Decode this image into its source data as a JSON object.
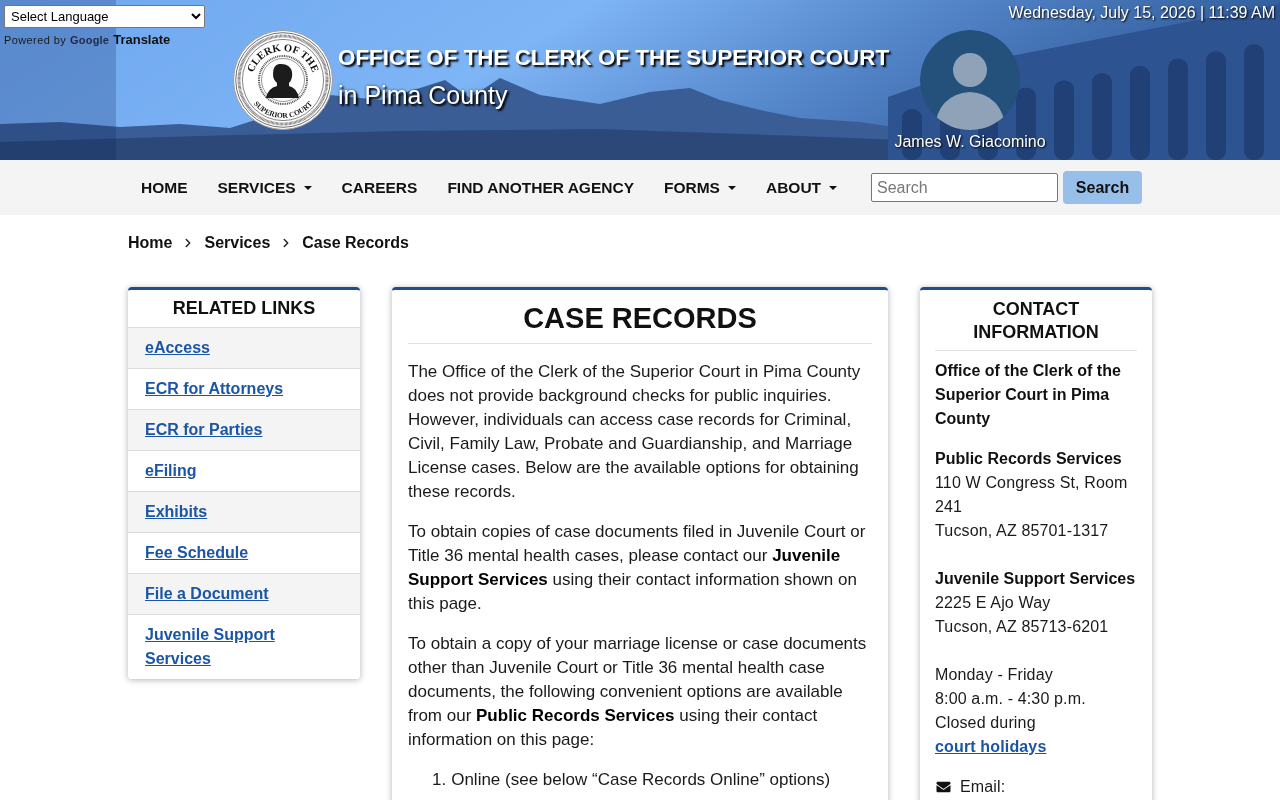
{
  "translate": {
    "select": {
      "value": "Select Language"
    },
    "powered_by": "Powered by",
    "google": "Google",
    "translate": "Translate"
  },
  "header": {
    "datetime": "Wednesday, July 15, 2026 | 11:39 AM",
    "seal": {
      "top_text": "CLERK OF THE",
      "bottom_text": "SUPERIOR COURT"
    },
    "title": "OFFICE OF THE CLERK OF THE SUPERIOR COURT",
    "subtitle": "in Pima County",
    "official_name": "James W. Giacomino"
  },
  "nav": {
    "items": [
      {
        "label": "HOME",
        "kind": "link"
      },
      {
        "label": "SERVICES",
        "kind": "dropdown"
      },
      {
        "label": "CAREERS",
        "kind": "link"
      },
      {
        "label": "FIND ANOTHER AGENCY",
        "kind": "link"
      },
      {
        "label": "FORMS",
        "kind": "dropdown"
      },
      {
        "label": "ABOUT",
        "kind": "dropdown"
      }
    ],
    "search": {
      "placeholder": "Search"
    },
    "search_button": "Search"
  },
  "breadcrumb": [
    "Home",
    "Services",
    "Case Records"
  ],
  "related_links": {
    "title": "RELATED LINKS",
    "items": [
      "eAccess",
      "ECR for Attorneys",
      "ECR for Parties",
      "eFiling",
      "Exhibits",
      "Fee Schedule",
      "File a Document",
      "Juvenile Support Services"
    ]
  },
  "main": {
    "title": "CASE RECORDS",
    "paragraphs": [
      "The Office of the Clerk of the Superior Court in Pima County does not provide background checks for public inquiries. However, individuals can access case records for Criminal, Civil, Family Law, Probate and Guardianship, and Marriage License cases. Below are the available options for obtaining these records.",
      "To obtain copies of case documents filed in Juvenile Court or Title 36 mental health cases, please contact our **Juvenile Support Services** using their contact information shown on this page.",
      "To obtain a copy of your marriage license or case documents other than Juvenile Court or Title 36 mental health case documents, the following convenient options are available from our **Public Records Services** using their contact information on this page:"
    ],
    "list": [
      {
        "number": "1.",
        "text": "Online (see below “Case Records Online” options)"
      }
    ]
  },
  "contact": {
    "title": "CONTACT INFORMATION",
    "office": "Office of the Clerk of the Superior Court in Pima County",
    "offices": [
      {
        "name": "Public Records Services",
        "lines": [
          "110 W Congress St, Room 241",
          "Tucson, AZ 85701-1317"
        ]
      },
      {
        "name": "Juvenile Support Services",
        "lines": [
          "2225 E Ajo Way",
          "Tucson, AZ 85713-6201"
        ]
      }
    ],
    "hours": [
      "Monday - Friday",
      "8:00 a.m. - 4:30 p.m."
    ],
    "closed": {
      "text": "Closed during",
      "link": "court holidays"
    },
    "email_label": "Email:"
  }
}
